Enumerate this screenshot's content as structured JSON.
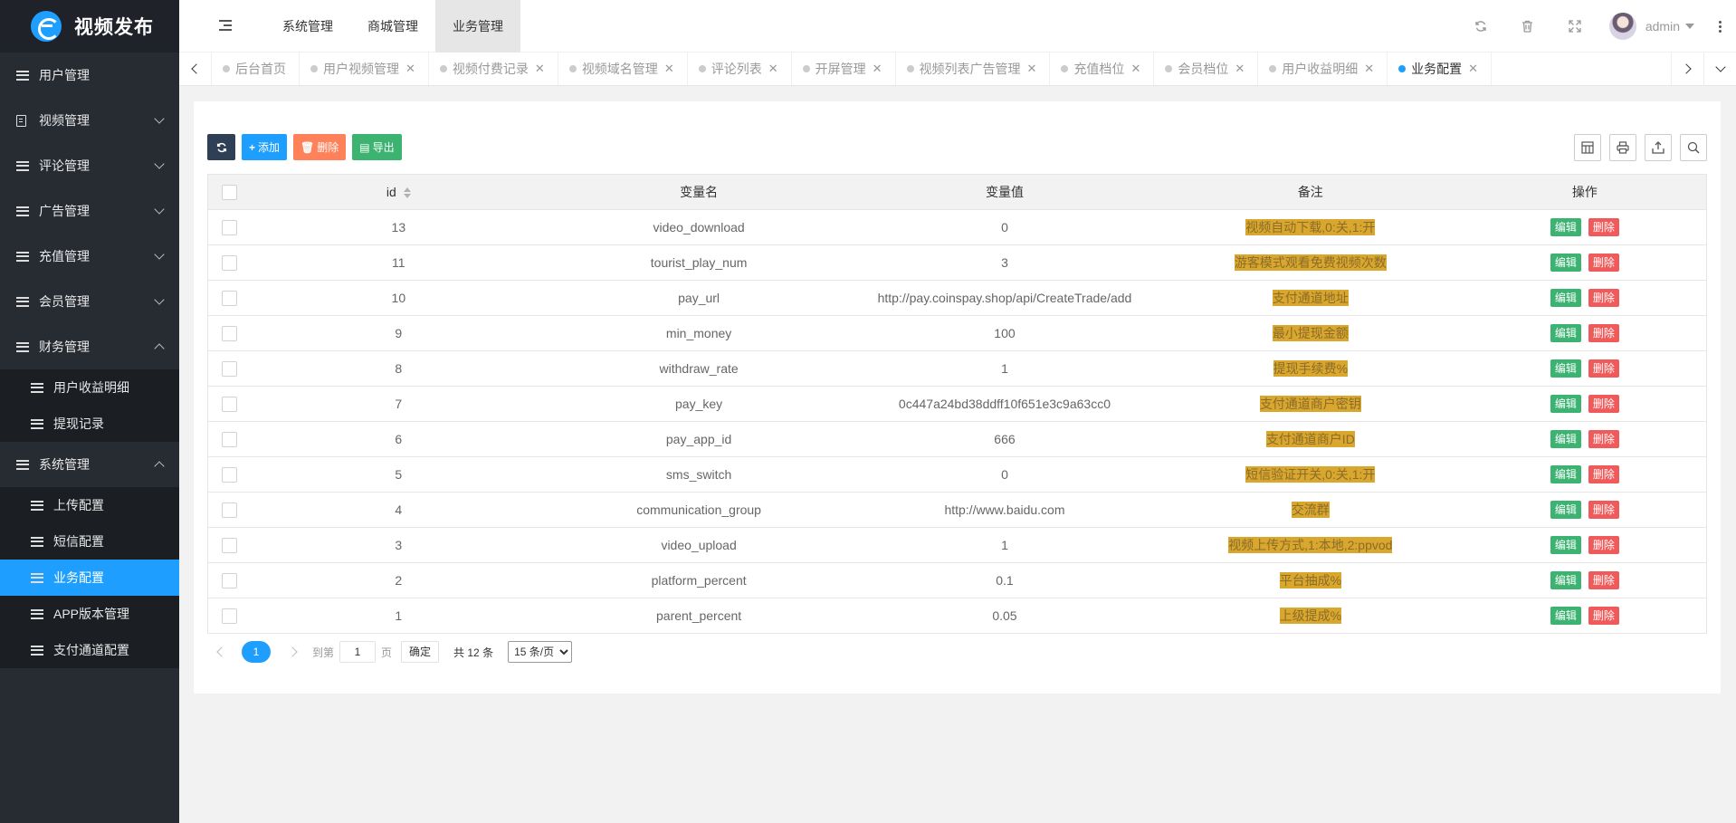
{
  "app": {
    "title": "视频发布"
  },
  "colors": {
    "accent": "#1e9fff",
    "sidebar_bg": "#272c33",
    "remark_bg": "#d9a62e",
    "edit": "#3cb371",
    "delete": "#f15a5a"
  },
  "sidebar": {
    "menus": [
      {
        "label": "用户管理",
        "icon": "list-icon"
      },
      {
        "label": "视频管理",
        "icon": "doc-icon"
      },
      {
        "label": "评论管理",
        "icon": "list-icon"
      },
      {
        "label": "广告管理",
        "icon": "list-icon"
      },
      {
        "label": "充值管理",
        "icon": "list-icon"
      },
      {
        "label": "会员管理",
        "icon": "list-icon"
      },
      {
        "label": "财务管理",
        "icon": "list-icon"
      },
      {
        "label": "系统管理",
        "icon": "list-icon"
      }
    ],
    "finance_sub": [
      "用户收益明细",
      "提现记录"
    ],
    "system_sub": [
      "上传配置",
      "短信配置",
      "业务配置",
      "APP版本管理",
      "支付通道配置"
    ]
  },
  "header": {
    "nav": [
      "系统管理",
      "商城管理",
      "业务管理"
    ],
    "user": "admin",
    "icons": [
      "refresh-icon",
      "trash-icon",
      "fullscreen-icon",
      "more-icon"
    ]
  },
  "tabs": [
    "后台首页",
    "用户视频管理",
    "视频付费记录",
    "视频域名管理",
    "评论列表",
    "开屏管理",
    "视频列表广告管理",
    "充值档位",
    "会员档位",
    "用户收益明细",
    "业务配置"
  ],
  "toolbar": {
    "add": "添加",
    "delete": "删除",
    "export": "导出"
  },
  "table": {
    "columns": [
      "id",
      "变量名",
      "变量值",
      "备注",
      "操作"
    ],
    "edit_label": "编辑",
    "delete_label": "删除",
    "rows": [
      {
        "id": "13",
        "name": "video_download",
        "value": "0",
        "remark": "视频自动下载,0:关,1:开"
      },
      {
        "id": "11",
        "name": "tourist_play_num",
        "value": "3",
        "remark": "游客模式观看免费视频次数"
      },
      {
        "id": "10",
        "name": "pay_url",
        "value": "http://pay.coinspay.shop/api/CreateTrade/add",
        "remark": "支付通道地址"
      },
      {
        "id": "9",
        "name": "min_money",
        "value": "100",
        "remark": "最小提现金额"
      },
      {
        "id": "8",
        "name": "withdraw_rate",
        "value": "1",
        "remark": "提现手续费%"
      },
      {
        "id": "7",
        "name": "pay_key",
        "value": "0c447a24bd38ddff10f651e3c9a63cc0",
        "remark": "支付通道商户密钥"
      },
      {
        "id": "6",
        "name": "pay_app_id",
        "value": "666",
        "remark": "支付通道商户ID"
      },
      {
        "id": "5",
        "name": "sms_switch",
        "value": "0",
        "remark": "短信验证开关,0:关,1:开"
      },
      {
        "id": "4",
        "name": "communication_group",
        "value": "http://www.baidu.com",
        "remark": "交流群"
      },
      {
        "id": "3",
        "name": "video_upload",
        "value": "1",
        "remark": "视频上传方式,1:本地,2:ppvod"
      },
      {
        "id": "2",
        "name": "platform_percent",
        "value": "0.1",
        "remark": "平台抽成%"
      },
      {
        "id": "1",
        "name": "parent_percent",
        "value": "0.05",
        "remark": "上级提成%"
      }
    ]
  },
  "pager": {
    "current": "1",
    "goto_label": "到第",
    "page_input": "1",
    "page_unit": "页",
    "confirm": "确定",
    "total": "共 12 条",
    "page_size": "15 条/页"
  }
}
